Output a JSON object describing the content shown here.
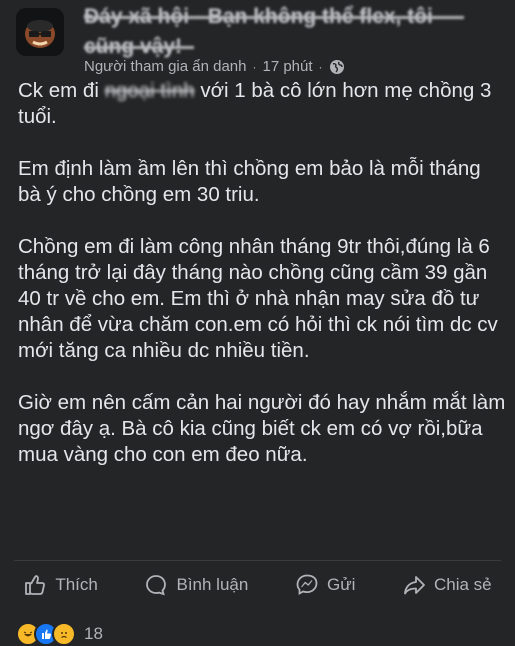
{
  "post": {
    "group_title_line1": "Đáy xã hội - Bạn không thể flex, tôi",
    "group_title_line2": "cũng vậy!",
    "author": "Người tham gia ẩn danh",
    "time": "17 phút",
    "privacy_icon": "globe-icon",
    "paragraphs": [
      [
        "Ck em đi ",
        "ngoại tình",
        " với 1 bà cô lớn hơn mẹ chồng 3 tuổi."
      ],
      "Em định làm ầm lên thì chồng em bảo là mỗi tháng bà ý cho chồng em 30 triu.",
      "Chồng em đi làm công nhân tháng 9tr thôi,đúng là 6 tháng trở lại đây tháng nào chồng cũng cầm 39 gần 40 tr về cho em. Em thì ở nhà nhận may sửa đồ tư nhân để vừa chăm con.em có hỏi thì ck nói tìm dc cv mới tăng ca nhiều dc nhiều tiền.",
      "Giờ em nên cấm cản hai người đó hay nhắm mắt làm ngơ đây ạ. Bà cô kia cũng biết ck em có vợ rồi,bữa mua vàng cho con em đeo nữa."
    ]
  },
  "actions": {
    "like": "Thích",
    "comment": "Bình luận",
    "send": "Gửi",
    "share": "Chia sẻ"
  },
  "reactions": {
    "count": "18",
    "icons": [
      "haha-icon",
      "like-icon",
      "sad-icon"
    ]
  }
}
